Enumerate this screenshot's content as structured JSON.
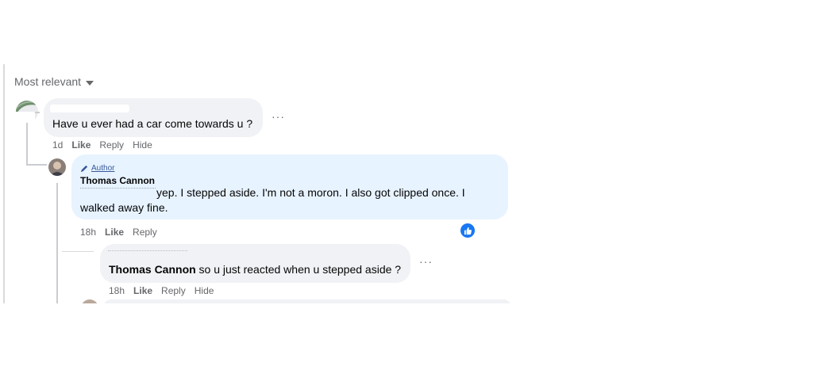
{
  "sort": {
    "label": "Most relevant"
  },
  "comments": [
    {
      "text": "Have u ever had a car come towards u ?",
      "time": "1d",
      "actions": [
        "Like",
        "Reply",
        "Hide"
      ],
      "more": "···"
    },
    {
      "badge": "Author",
      "name": "Thomas Cannon",
      "text_line1": "yep. I stepped aside. I'm not a moron. I also got clipped once. I",
      "text_line2": "walked away fine.",
      "time": "18h",
      "actions": [
        "Like",
        "Reply"
      ]
    },
    {
      "mention": "Thomas Cannon",
      "text": " so u just reacted when u stepped aside ?",
      "time": "18h",
      "actions": [
        "Like",
        "Reply",
        "Hide"
      ],
      "more": "···"
    }
  ],
  "colors": {
    "accent": "#1877f2",
    "bubble": "#f0f2f5",
    "author_bubble": "#e7f3ff",
    "muted": "#65676b"
  },
  "icons": {
    "sort": "caret-down-icon",
    "author": "pencil-icon",
    "reaction": "thumbs-up-icon"
  }
}
